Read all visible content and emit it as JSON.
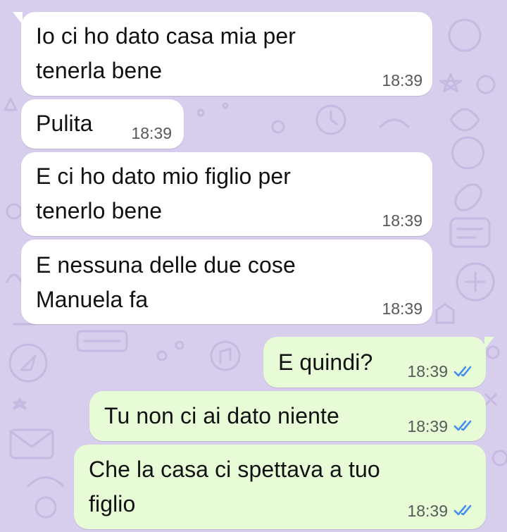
{
  "chat": {
    "messages": [
      {
        "direction": "in",
        "text": "Io ci ho dato casa mia per\ntenerla bene",
        "time": "18:39"
      },
      {
        "direction": "in",
        "text": "Pulita",
        "time": "18:39"
      },
      {
        "direction": "in",
        "text": "E ci ho dato mio figlio per\ntenerlo bene",
        "time": "18:39"
      },
      {
        "direction": "in",
        "text": "E nessuna delle due cose\nManuela fa",
        "time": "18:39"
      },
      {
        "direction": "out",
        "text": "E quindi?",
        "time": "18:39",
        "status": "read",
        "status_icon": "double-check-icon"
      },
      {
        "direction": "out",
        "text": "Tu non ci ai dato niente",
        "time": "18:39",
        "status": "read",
        "status_icon": "double-check-icon"
      },
      {
        "direction": "out",
        "text": "Che la casa ci spettava a tuo\nfiglio",
        "time": "18:39",
        "status": "read",
        "status_icon": "double-check-icon"
      }
    ]
  },
  "colors": {
    "wallpaper": "#d7cdec",
    "incoming_bubble": "#ffffff",
    "outgoing_bubble": "#e7fcd6",
    "read_ticks": "#3d8bf0",
    "timestamp": "#555a57"
  }
}
